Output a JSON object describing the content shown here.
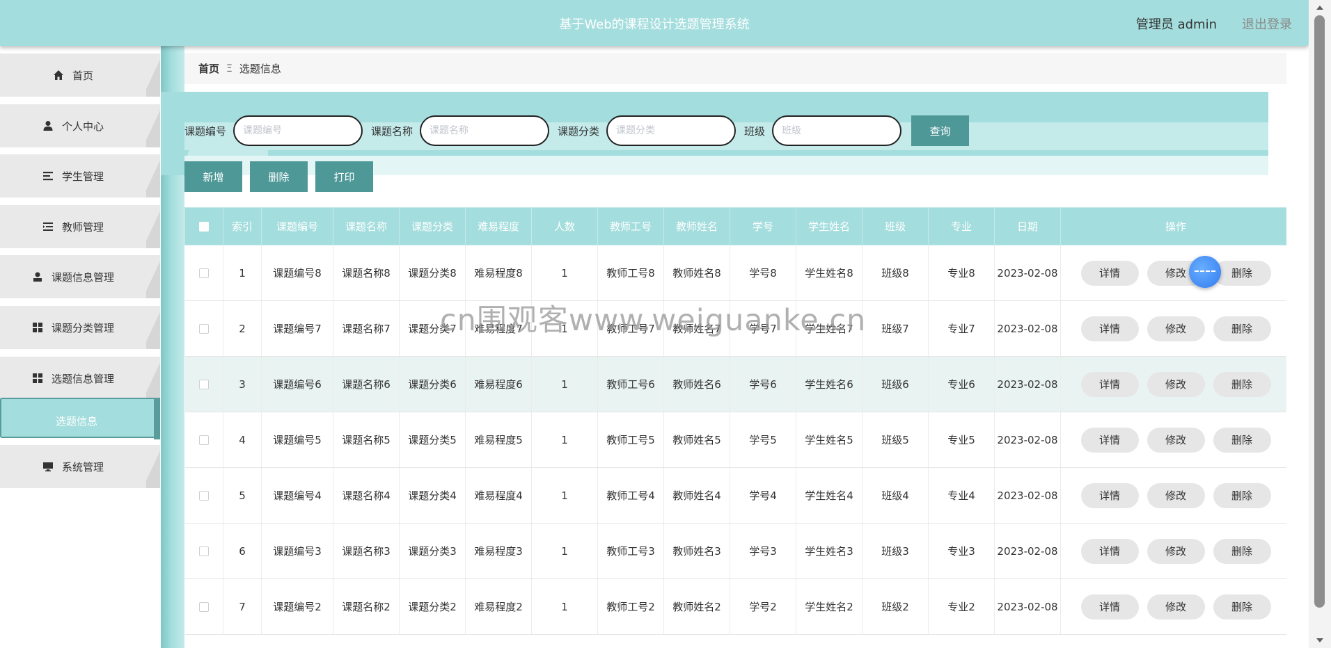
{
  "header": {
    "title": "基于Web的课程设计选题管理系统",
    "user": "管理员 admin",
    "logout": "退出登录"
  },
  "sidebar": {
    "items": [
      {
        "label": "首页",
        "icon": "home-icon"
      },
      {
        "label": "个人中心",
        "icon": "user-icon"
      },
      {
        "label": "学生管理",
        "icon": "list-icon"
      },
      {
        "label": "教师管理",
        "icon": "list-indent-icon"
      },
      {
        "label": "课题信息管理",
        "icon": "person-badge-icon"
      },
      {
        "label": "课题分类管理",
        "icon": "grid-icon"
      },
      {
        "label": "选题信息管理",
        "icon": "grid-icon"
      },
      {
        "label": "选题信息",
        "icon": ""
      },
      {
        "label": "系统管理",
        "icon": "monitor-icon"
      }
    ]
  },
  "breadcrumb": {
    "home": "首页",
    "separator": "Ξ",
    "current": "选题信息"
  },
  "search": {
    "fields": [
      {
        "label": "课题编号",
        "placeholder": "课题编号"
      },
      {
        "label": "课题名称",
        "placeholder": "课题名称"
      },
      {
        "label": "课题分类",
        "placeholder": "课题分类"
      },
      {
        "label": "班级",
        "placeholder": "班级"
      }
    ],
    "query_label": "查询"
  },
  "actions": {
    "add": "新增",
    "delete": "删除",
    "print": "打印"
  },
  "table": {
    "columns": [
      "索引",
      "课题编号",
      "课题名称",
      "课题分类",
      "难易程度",
      "人数",
      "教师工号",
      "教师姓名",
      "学号",
      "学生姓名",
      "班级",
      "专业",
      "日期",
      "操作"
    ],
    "rows": [
      [
        "1",
        "课题编号8",
        "课题名称8",
        "课题分类8",
        "难易程度8",
        "1",
        "教师工号8",
        "教师姓名8",
        "学号8",
        "学生姓名8",
        "班级8",
        "专业8",
        "2023-02-08"
      ],
      [
        "2",
        "课题编号7",
        "课题名称7",
        "课题分类7",
        "难易程度7",
        "1",
        "教师工号7",
        "教师姓名7",
        "学号7",
        "学生姓名7",
        "班级7",
        "专业7",
        "2023-02-08"
      ],
      [
        "3",
        "课题编号6",
        "课题名称6",
        "课题分类6",
        "难易程度6",
        "1",
        "教师工号6",
        "教师姓名6",
        "学号6",
        "学生姓名6",
        "班级6",
        "专业6",
        "2023-02-08"
      ],
      [
        "4",
        "课题编号5",
        "课题名称5",
        "课题分类5",
        "难易程度5",
        "1",
        "教师工号5",
        "教师姓名5",
        "学号5",
        "学生姓名5",
        "班级5",
        "专业5",
        "2023-02-08"
      ],
      [
        "5",
        "课题编号4",
        "课题名称4",
        "课题分类4",
        "难易程度4",
        "1",
        "教师工号4",
        "教师姓名4",
        "学号4",
        "学生姓名4",
        "班级4",
        "专业4",
        "2023-02-08"
      ],
      [
        "6",
        "课题编号3",
        "课题名称3",
        "课题分类3",
        "难易程度3",
        "1",
        "教师工号3",
        "教师姓名3",
        "学号3",
        "学生姓名3",
        "班级3",
        "专业3",
        "2023-02-08"
      ],
      [
        "7",
        "课题编号2",
        "课题名称2",
        "课题分类2",
        "难易程度2",
        "1",
        "教师工号2",
        "教师姓名2",
        "学号2",
        "学生姓名2",
        "班级2",
        "专业2",
        "2023-02-08"
      ]
    ],
    "row_actions": {
      "detail": "详情",
      "edit": "修改",
      "delete": "删除"
    }
  },
  "watermark": "cn围观客www.weiguanke.cn",
  "colors": {
    "accent": "#a4dddd",
    "button": "#4f9898",
    "stripe": "#e9f3f2"
  }
}
